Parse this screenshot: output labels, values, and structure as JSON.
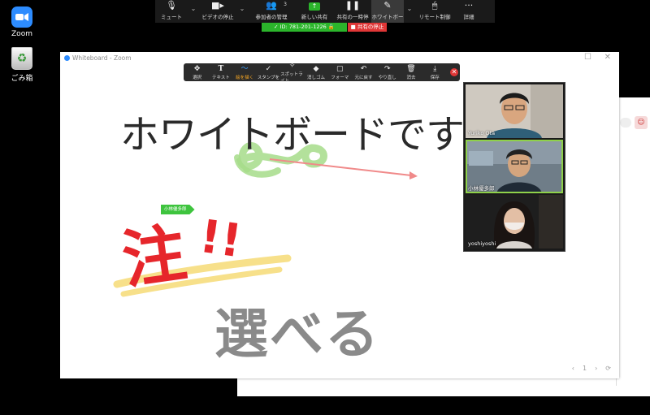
{
  "desktop": {
    "icons": [
      {
        "label": "Zoom"
      },
      {
        "label": "ごみ箱"
      }
    ]
  },
  "meeting_toolbar": {
    "items": [
      {
        "label": "ミュート",
        "icon": "microphone-icon"
      },
      {
        "label": "ビデオの停止",
        "icon": "video-camera-icon"
      },
      {
        "label": "参加者の管理",
        "icon": "participants-icon",
        "count": "3"
      },
      {
        "label": "新しい共有",
        "icon": "share-screen-icon"
      },
      {
        "label": "共有の一時停",
        "icon": "pause-icon"
      },
      {
        "label": "ホワイトボー",
        "icon": "pencil-icon"
      },
      {
        "label": "リモート制御",
        "icon": "mouse-icon"
      },
      {
        "label": "詳細",
        "icon": "more-icon"
      }
    ],
    "meeting_id": "ID: 781-201-1226",
    "stop_share": "共有の停止"
  },
  "whiteboard": {
    "window_title": "Whiteboard - Zoom",
    "tools": [
      {
        "label": "選択",
        "icon": "move-icon"
      },
      {
        "label": "テキスト",
        "icon": "text-icon"
      },
      {
        "label": "絵を描く",
        "icon": "draw-icon",
        "selected": true
      },
      {
        "label": "スタンプを",
        "icon": "stamp-icon"
      },
      {
        "label": "スポットライト",
        "icon": "spotlight-icon"
      },
      {
        "label": "消しゴム",
        "icon": "eraser-icon"
      },
      {
        "label": "フォーマ",
        "icon": "format-icon"
      },
      {
        "label": "元に戻す",
        "icon": "undo-icon"
      },
      {
        "label": "やり直し",
        "icon": "redo-icon"
      },
      {
        "label": "消去",
        "icon": "trash-icon"
      },
      {
        "label": "保存",
        "icon": "save-icon"
      }
    ],
    "canvas": {
      "heading": "ホワイトボードです",
      "chu": "注",
      "exclaim": "!!",
      "eraberu": "選べる",
      "annotator": "小林優多郎"
    },
    "page_number": "1",
    "colors": {
      "green_stroke": "#a6dc8a",
      "pink_arrow": "#f08a8a",
      "red_text": "#e6262b",
      "yellow_highlight": "#f7e08a",
      "gray_text": "#8a8a8a"
    }
  },
  "video_panel": {
    "participants": [
      {
        "name": "Yuriko Ota"
      },
      {
        "name": "小林優多郎"
      },
      {
        "name": "yoshiyoshi"
      }
    ]
  }
}
